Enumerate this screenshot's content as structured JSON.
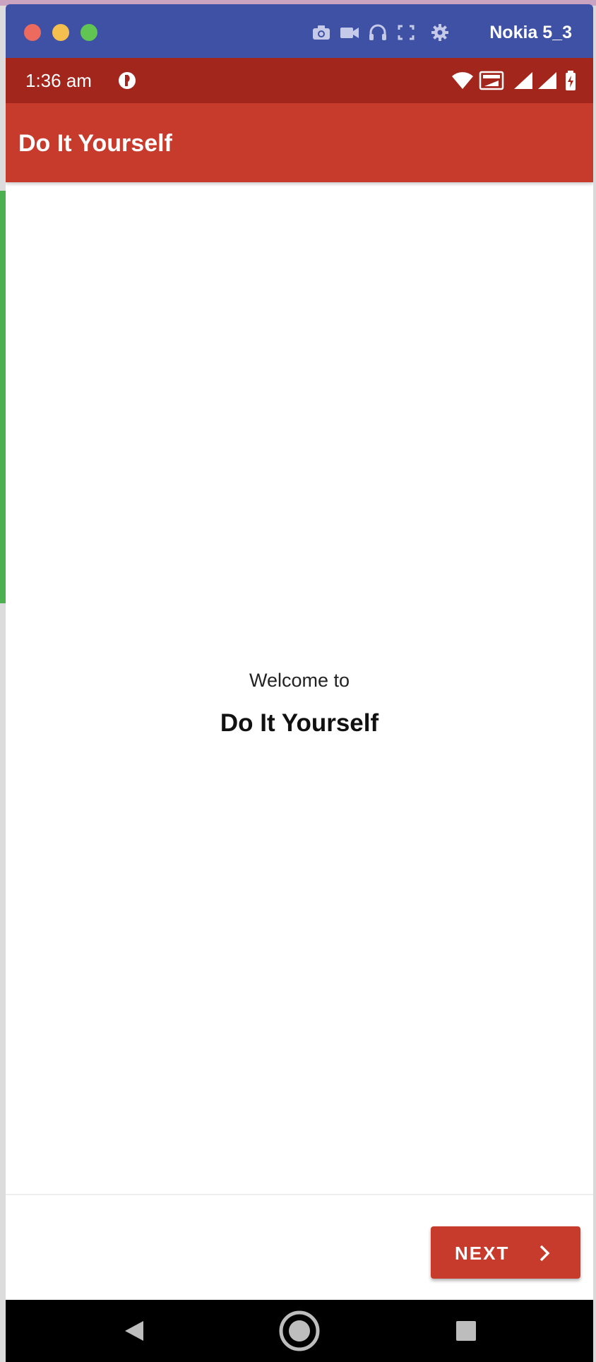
{
  "window": {
    "device_name": "Nokia 5_3",
    "title_bar_color": "#3f51a5",
    "traffic_lights": [
      "close",
      "minimize",
      "zoom"
    ],
    "toolbar_icons": [
      "camera-icon",
      "video-camera-icon",
      "headphones-icon",
      "fullscreen-icon",
      "gear-icon"
    ]
  },
  "status_bar": {
    "time": "1:36 am",
    "color": "#a3261c",
    "icons": [
      "notification-icon",
      "wifi-icon",
      "volte-icon",
      "signal-icon",
      "signal-icon",
      "battery-icon"
    ]
  },
  "app_bar": {
    "title": "Do It Yourself",
    "color": "#c73b2c"
  },
  "content": {
    "welcome_line": "Welcome to",
    "welcome_title": "Do It Yourself"
  },
  "footer": {
    "next_label": "NEXT",
    "next_icon": "chevron-right-icon"
  },
  "nav_bar": {
    "buttons": [
      "back-icon",
      "home-icon",
      "recents-icon"
    ]
  }
}
